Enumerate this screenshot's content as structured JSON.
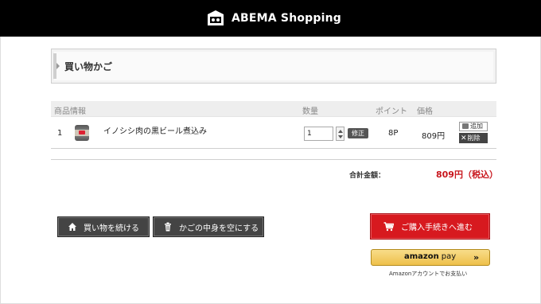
{
  "header": {
    "brand": "ABEMA Shopping"
  },
  "page": {
    "title": "買い物かご"
  },
  "cart_table": {
    "headers": {
      "product": "商品情報",
      "quantity": "数量",
      "points": "ポイント",
      "price": "価格"
    },
    "rows": [
      {
        "index": "1",
        "name": "イノシシ肉の黒ビール煮込み",
        "quantity": "1",
        "fix_label": "修正",
        "points": "8P",
        "price": "809円",
        "add_label": "追加",
        "delete_label": "削除"
      }
    ]
  },
  "summary": {
    "total_label": "合計金額：",
    "total_value": "809円（税込）"
  },
  "actions": {
    "continue_label": "買い物を続ける",
    "empty_label": "かごの中身を空にする",
    "checkout_label": "ご購入手続きへ進む",
    "amazon_brand": "amazon",
    "amazon_pay": "pay",
    "amazon_chevron": "»",
    "amazon_caption": "Amazonアカウントでお支払い"
  },
  "icons": {
    "brand": "abema-logo-icon",
    "continue": "home-icon",
    "empty": "trash-icon",
    "checkout": "cart-icon",
    "add": "heart-icon",
    "delete": "close-icon",
    "spinner": "spinner-arrows-icon"
  },
  "colors": {
    "topbar": "#000000",
    "accent_red": "#d7191f",
    "price_red": "#c8161d",
    "dark_button": "#444444",
    "amazon_gold": "#f0c14b"
  }
}
